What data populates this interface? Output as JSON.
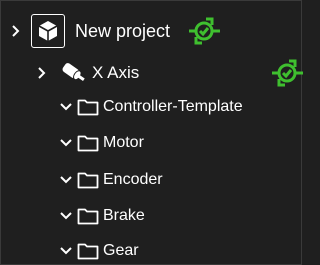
{
  "tree": {
    "root": {
      "label": "New project",
      "expanded": false
    },
    "axis": {
      "label": "X Axis",
      "expanded": false
    },
    "folders": [
      {
        "label": "Controller-Template"
      },
      {
        "label": "Motor"
      },
      {
        "label": "Encoder"
      },
      {
        "label": "Brake"
      },
      {
        "label": "Gear"
      }
    ]
  },
  "colors": {
    "background": "#1f1f1f",
    "text": "#ffffff",
    "accent_green": "#3fbf2f",
    "icon_stroke": "#ffffff"
  },
  "icons": {
    "project": "cube-icon",
    "axis": "motor-axis-icon",
    "status": "connected-status-icon",
    "folder": "folder-icon",
    "expand_collapsed": "chevron-right-icon",
    "expand_open": "chevron-down-icon"
  }
}
